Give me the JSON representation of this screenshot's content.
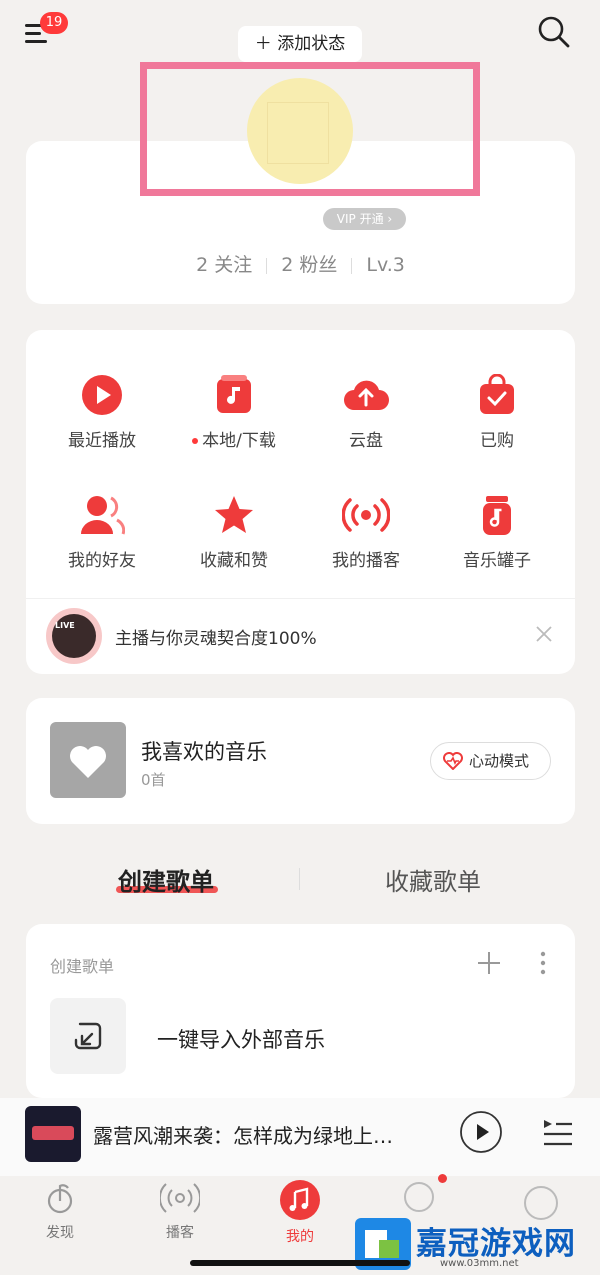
{
  "header": {
    "menu_badge": "19",
    "add_status": "＋ 添加状态"
  },
  "profile": {
    "vip_badge": "VIP 开通 ›",
    "stats": {
      "following": "2 关注",
      "followers": "2 粉丝",
      "level": "Lv.3"
    }
  },
  "features": [
    {
      "label": "最近播放",
      "icon": "play-icon"
    },
    {
      "label": "本地/下载",
      "icon": "music-note-icon",
      "has_dot": true
    },
    {
      "label": "云盘",
      "icon": "cloud-upload-icon"
    },
    {
      "label": "已购",
      "icon": "shopping-bag-icon"
    },
    {
      "label": "我的好友",
      "icon": "friends-icon"
    },
    {
      "label": "收藏和赞",
      "icon": "star-icon"
    },
    {
      "label": "我的播客",
      "icon": "podcast-icon"
    },
    {
      "label": "音乐罐子",
      "icon": "music-jar-icon"
    }
  ],
  "live_banner": {
    "tag": "LIVE",
    "text": "主播与你灵魂契合度100%"
  },
  "liked": {
    "title": "我喜欢的音乐",
    "count": "0首",
    "mode_button": "心动模式"
  },
  "tabs": {
    "created": "创建歌单",
    "collected": "收藏歌单"
  },
  "playlists": {
    "header": "创建歌单",
    "import_label": "一键导入外部音乐"
  },
  "mini_player": {
    "title": "露营风潮来袭：怎样成为绿地上…"
  },
  "bottom_nav": [
    {
      "label": "发现",
      "icon": "discover-icon"
    },
    {
      "label": "播客",
      "icon": "podcast-icon"
    },
    {
      "label": "我的",
      "icon": "music-note-icon"
    }
  ],
  "watermark": {
    "text": "嘉冠游戏网",
    "url": "www.03mm.net"
  },
  "colors": {
    "accent": "#ee3b3b",
    "background": "#f3f1ef",
    "highlight_frame": "#f0789a"
  }
}
